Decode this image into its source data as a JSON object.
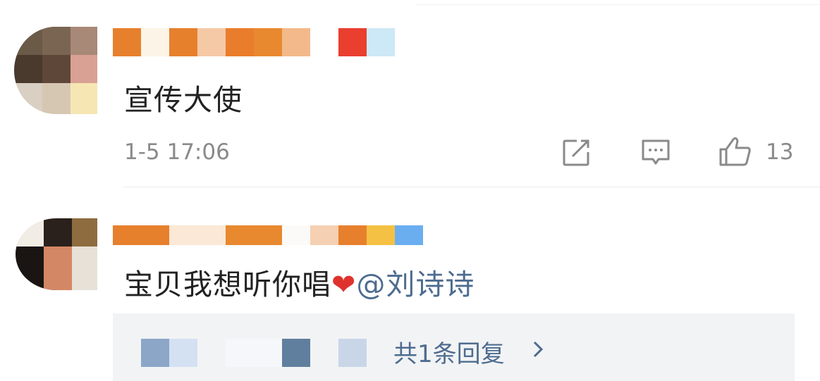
{
  "comments": [
    {
      "text": "宣传大使",
      "time": "1-5 17:06",
      "likes": "13",
      "icons": [
        "share-icon",
        "comment-icon",
        "like-icon"
      ]
    },
    {
      "text_main": "宝贝我想听你唱",
      "heart": "❤",
      "mention": "@刘诗诗",
      "reply_summary": "共1条回复",
      "reply_chevron": "chevron-right-icon"
    }
  ],
  "colors": {
    "text": "#222222",
    "meta": "#8a8a8a",
    "link": "#4e6c8f",
    "reply_bg": "#f2f3f5",
    "heart": "#e0322d"
  }
}
